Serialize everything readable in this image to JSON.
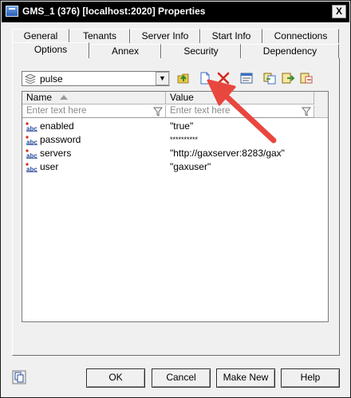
{
  "window": {
    "title": "GMS_1 (376) [localhost:2020] Properties",
    "close_label": "X"
  },
  "tabs": {
    "row1": [
      {
        "label": "General"
      },
      {
        "label": "Tenants"
      },
      {
        "label": "Server Info"
      },
      {
        "label": "Start Info"
      },
      {
        "label": "Connections"
      }
    ],
    "row2": [
      {
        "label": "Options",
        "active": true
      },
      {
        "label": "Annex"
      },
      {
        "label": "Security"
      },
      {
        "label": "Dependency"
      }
    ]
  },
  "toolbar": {
    "section_value": "pulse",
    "icons": [
      "folder-up-icon",
      "new-document-icon",
      "delete-icon",
      "properties-icon",
      "copy-icon",
      "export-icon",
      "import-icon"
    ]
  },
  "grid": {
    "columns": [
      {
        "header": "Name",
        "filter_placeholder": "Enter text here"
      },
      {
        "header": "Value",
        "filter_placeholder": "Enter text here"
      }
    ],
    "rows": [
      {
        "name": "enabled",
        "value": "\"true\""
      },
      {
        "name": "password",
        "value": "**********"
      },
      {
        "name": "servers",
        "value": "\"http://gaxserver:8283/gax\""
      },
      {
        "name": "user",
        "value": "\"gaxuser\""
      }
    ]
  },
  "buttons": {
    "ok": "OK",
    "cancel": "Cancel",
    "make_new": "Make New",
    "help": "Help"
  },
  "colors": {
    "annotation_arrow": "#e8473e",
    "titlebar": "#000000"
  }
}
